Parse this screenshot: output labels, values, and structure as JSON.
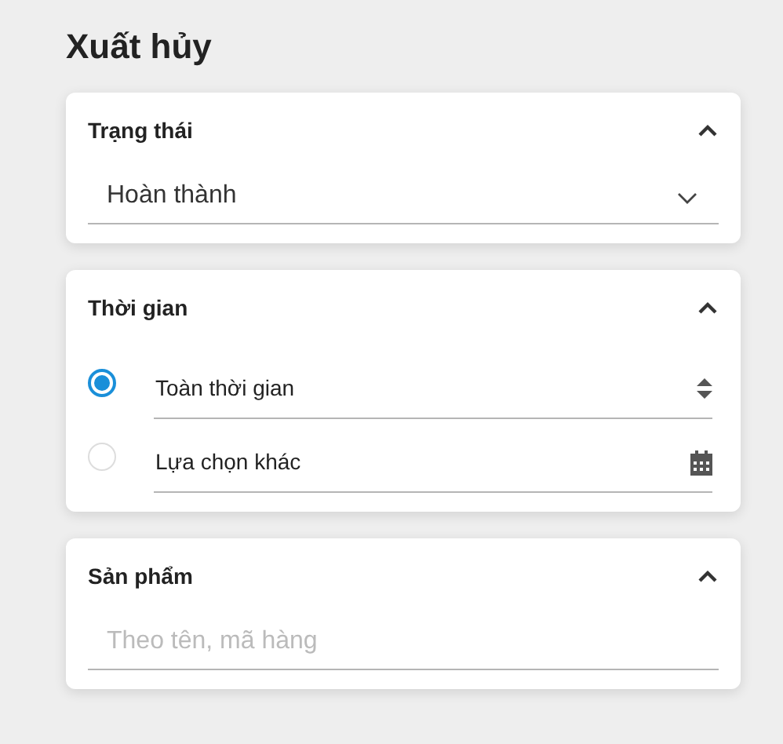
{
  "page_title": "Xuất hủy",
  "sections": [
    {
      "kind": "select",
      "title": "Trạng thái",
      "expanded": true,
      "value": "Hoàn thành"
    },
    {
      "kind": "radio",
      "title": "Thời gian",
      "expanded": true,
      "options": [
        {
          "label": "Toàn thời gian",
          "selected": true,
          "kind": "spinner"
        },
        {
          "label": "Lựa chọn khác",
          "selected": false,
          "kind": "date"
        }
      ]
    },
    {
      "kind": "search",
      "title": "Sản phẩm",
      "expanded": true,
      "placeholder": "Theo tên, mã hàng"
    }
  ]
}
